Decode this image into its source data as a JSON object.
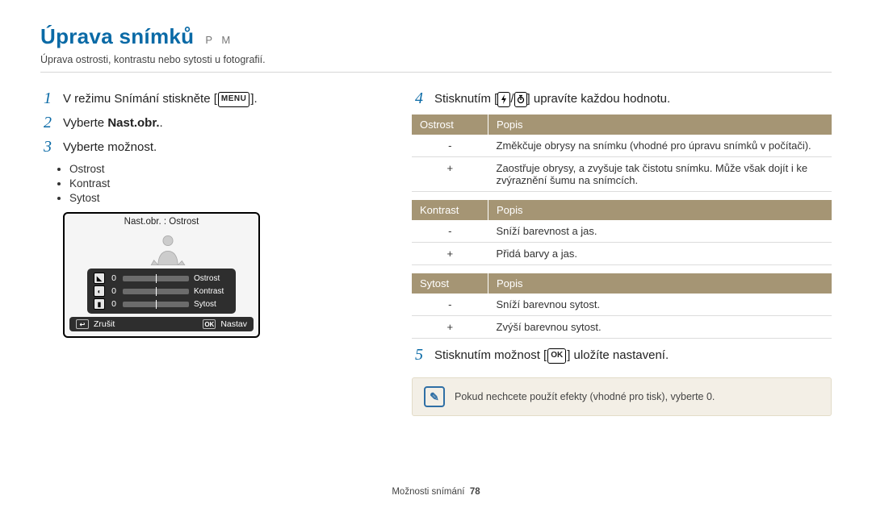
{
  "heading": {
    "title": "Úprava snímků",
    "suffix": "P M"
  },
  "subtitle": "Úprava ostrosti, kontrastu nebo sytosti u fotografií.",
  "left": {
    "steps": [
      {
        "num": "1",
        "before": "V režimu Snímání stiskněte [",
        "icon": "MENU",
        "after": "]."
      },
      {
        "num": "2",
        "html": "Vyberte <b>Nast.obr.</b>."
      },
      {
        "num": "3",
        "text": "Vyberte možnost."
      }
    ],
    "bullets": [
      "Ostrost",
      "Kontrast",
      "Sytost"
    ],
    "screenshot": {
      "title": "Nast.obr. : Ostrost",
      "rows": [
        {
          "icon": "◣",
          "val": "0",
          "label": "Ostrost"
        },
        {
          "icon": "◐",
          "val": "0",
          "label": "Kontrast"
        },
        {
          "icon": "▮",
          "val": "0",
          "label": "Sytost"
        }
      ],
      "footer": {
        "leftIcon": "↩",
        "leftLabel": "Zrušit",
        "rightIcon": "OK",
        "rightLabel": "Nastav"
      }
    }
  },
  "right": {
    "step4": {
      "num": "4",
      "before": "Stisknutím [",
      "mid": "/",
      "after": "] upravíte každou hodnotu."
    },
    "tables": [
      {
        "headers": [
          "Ostrost",
          "Popis"
        ],
        "rows": [
          {
            "sign": "-",
            "desc": "Změkčuje obrysy na snímku (vhodné pro úpravu snímků v počítači)."
          },
          {
            "sign": "+",
            "desc": "Zaostřuje obrysy, a zvyšuje tak čistotu snímku. Může však dojít i ke zvýraznění šumu na snímcích."
          }
        ]
      },
      {
        "headers": [
          "Kontrast",
          "Popis"
        ],
        "rows": [
          {
            "sign": "-",
            "desc": "Sníží barevnost a jas."
          },
          {
            "sign": "+",
            "desc": "Přidá barvy a jas."
          }
        ]
      },
      {
        "headers": [
          "Sytost",
          "Popis"
        ],
        "rows": [
          {
            "sign": "-",
            "desc": "Sníží barevnou sytost."
          },
          {
            "sign": "+",
            "desc": "Zvýší barevnou sytost."
          }
        ]
      }
    ],
    "step5": {
      "num": "5",
      "before": "Stisknutím možnost [",
      "icon": "OK",
      "after": "] uložíte nastavení."
    },
    "info": "Pokud nechcete použít efekty (vhodné pro tisk), vyberte 0."
  },
  "footer": {
    "section": "Možnosti snímání",
    "page": "78"
  }
}
